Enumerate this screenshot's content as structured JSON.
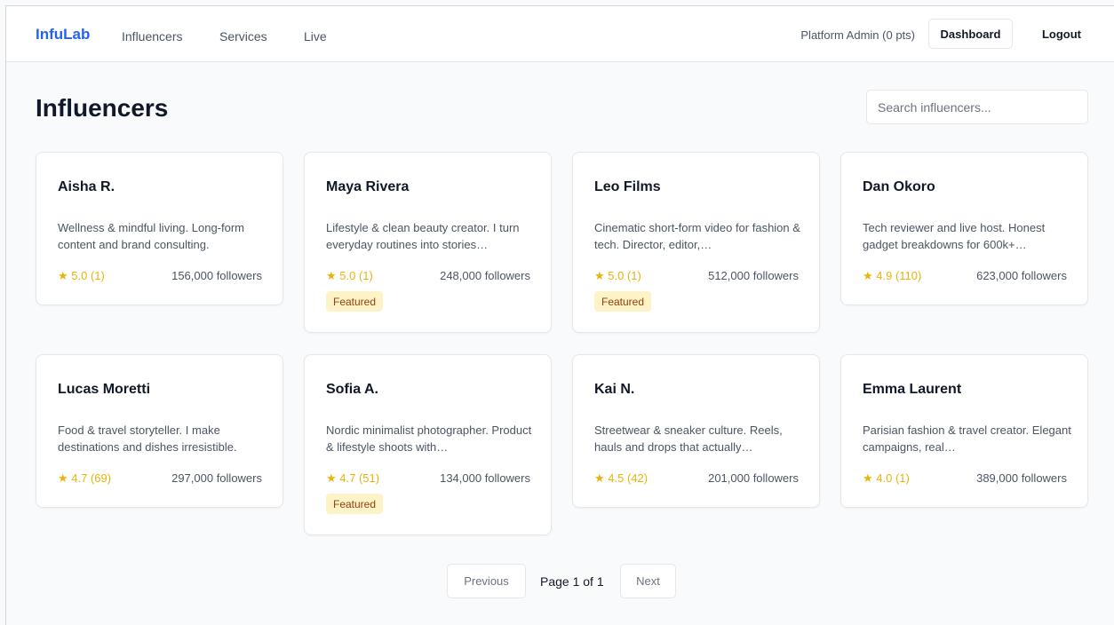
{
  "header": {
    "brand": "InfuLab",
    "nav": [
      "Influencers",
      "Services",
      "Live"
    ],
    "user": "Platform Admin (0 pts)",
    "dashboard_label": "Dashboard",
    "logout_label": "Logout"
  },
  "main": {
    "title": "Influencers",
    "search_placeholder": "Search influencers..."
  },
  "influencers": [
    {
      "name": "Aisha R.",
      "description": "Wellness & mindful living. Long-form content and brand consulting.",
      "rating": "5.0 (1)",
      "followers": "156,000 followers",
      "badge": ""
    },
    {
      "name": "Maya Rivera",
      "description": "Lifestyle & clean beauty creator. I turn everyday routines into stories…",
      "rating": "5.0 (1)",
      "followers": "248,000 followers",
      "badge": "Featured"
    },
    {
      "name": "Leo Films",
      "description": "Cinematic short-form video for fashion & tech. Director, editor,…",
      "rating": "5.0 (1)",
      "followers": "512,000 followers",
      "badge": "Featured"
    },
    {
      "name": "Dan Okoro",
      "description": "Tech reviewer and live host. Honest gadget breakdowns for 600k+…",
      "rating": "4.9 (110)",
      "followers": "623,000 followers",
      "badge": ""
    },
    {
      "name": "Lucas Moretti",
      "description": "Food & travel storyteller. I make destinations and dishes irresistible.",
      "rating": "4.7 (69)",
      "followers": "297,000 followers",
      "badge": ""
    },
    {
      "name": "Sofia A.",
      "description": "Nordic minimalist photographer. Product & lifestyle shoots with…",
      "rating": "4.7 (51)",
      "followers": "134,000 followers",
      "badge": "Featured"
    },
    {
      "name": "Kai N.",
      "description": "Streetwear & sneaker culture. Reels, hauls and drops that actually…",
      "rating": "4.5 (42)",
      "followers": "201,000 followers",
      "badge": ""
    },
    {
      "name": "Emma Laurent",
      "description": "Parisian fashion & travel creator. Elegant campaigns, real…",
      "rating": "4.0 (1)",
      "followers": "389,000 followers",
      "badge": ""
    }
  ],
  "star_glyph": "★",
  "pagination": {
    "previous_label": "Previous",
    "page_text": "Page 1 of 1",
    "next_label": "Next"
  },
  "colors": {
    "brand": "#2563eb",
    "star": "#eab308",
    "badge_bg": "#fef3c7"
  }
}
